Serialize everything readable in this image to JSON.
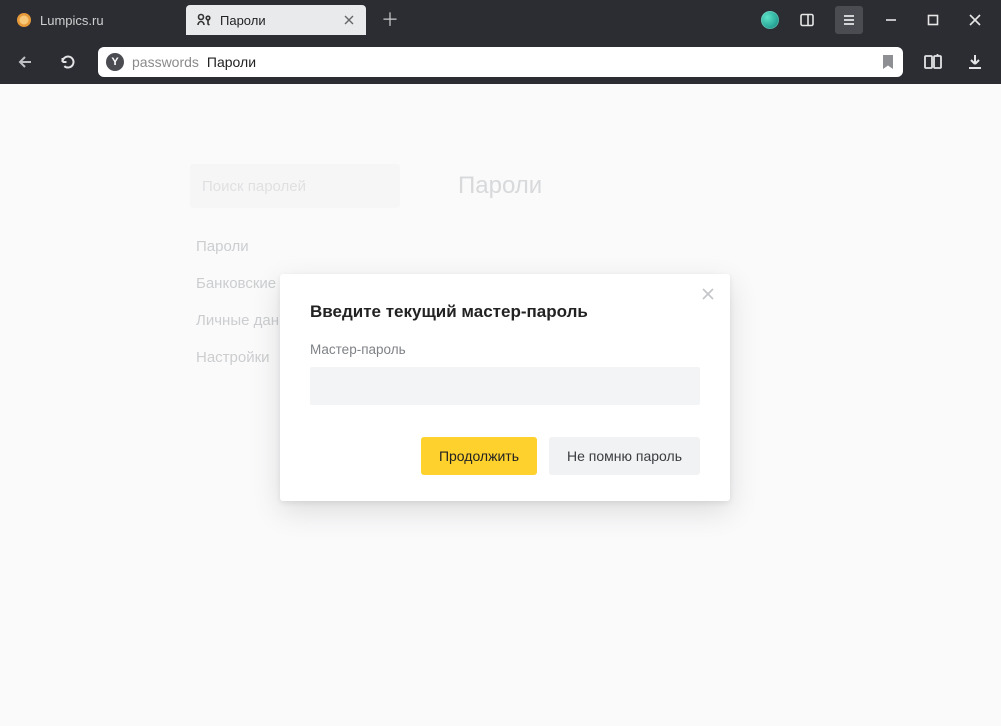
{
  "tabs": [
    {
      "title": "Lumpics.ru"
    },
    {
      "title": "Пароли"
    }
  ],
  "address": {
    "prefix": "passwords",
    "highlight": "Пароли"
  },
  "sidebar": {
    "search_placeholder": "Поиск паролей",
    "items": [
      {
        "label": "Пароли"
      },
      {
        "label": "Банковские карты"
      },
      {
        "label": "Личные данные"
      },
      {
        "label": "Настройки"
      }
    ]
  },
  "main": {
    "heading": "Пароли"
  },
  "modal": {
    "title": "Введите текущий мастер-пароль",
    "field_label": "Мастер-пароль",
    "continue_label": "Продолжить",
    "forgot_label": "Не помню пароль"
  }
}
